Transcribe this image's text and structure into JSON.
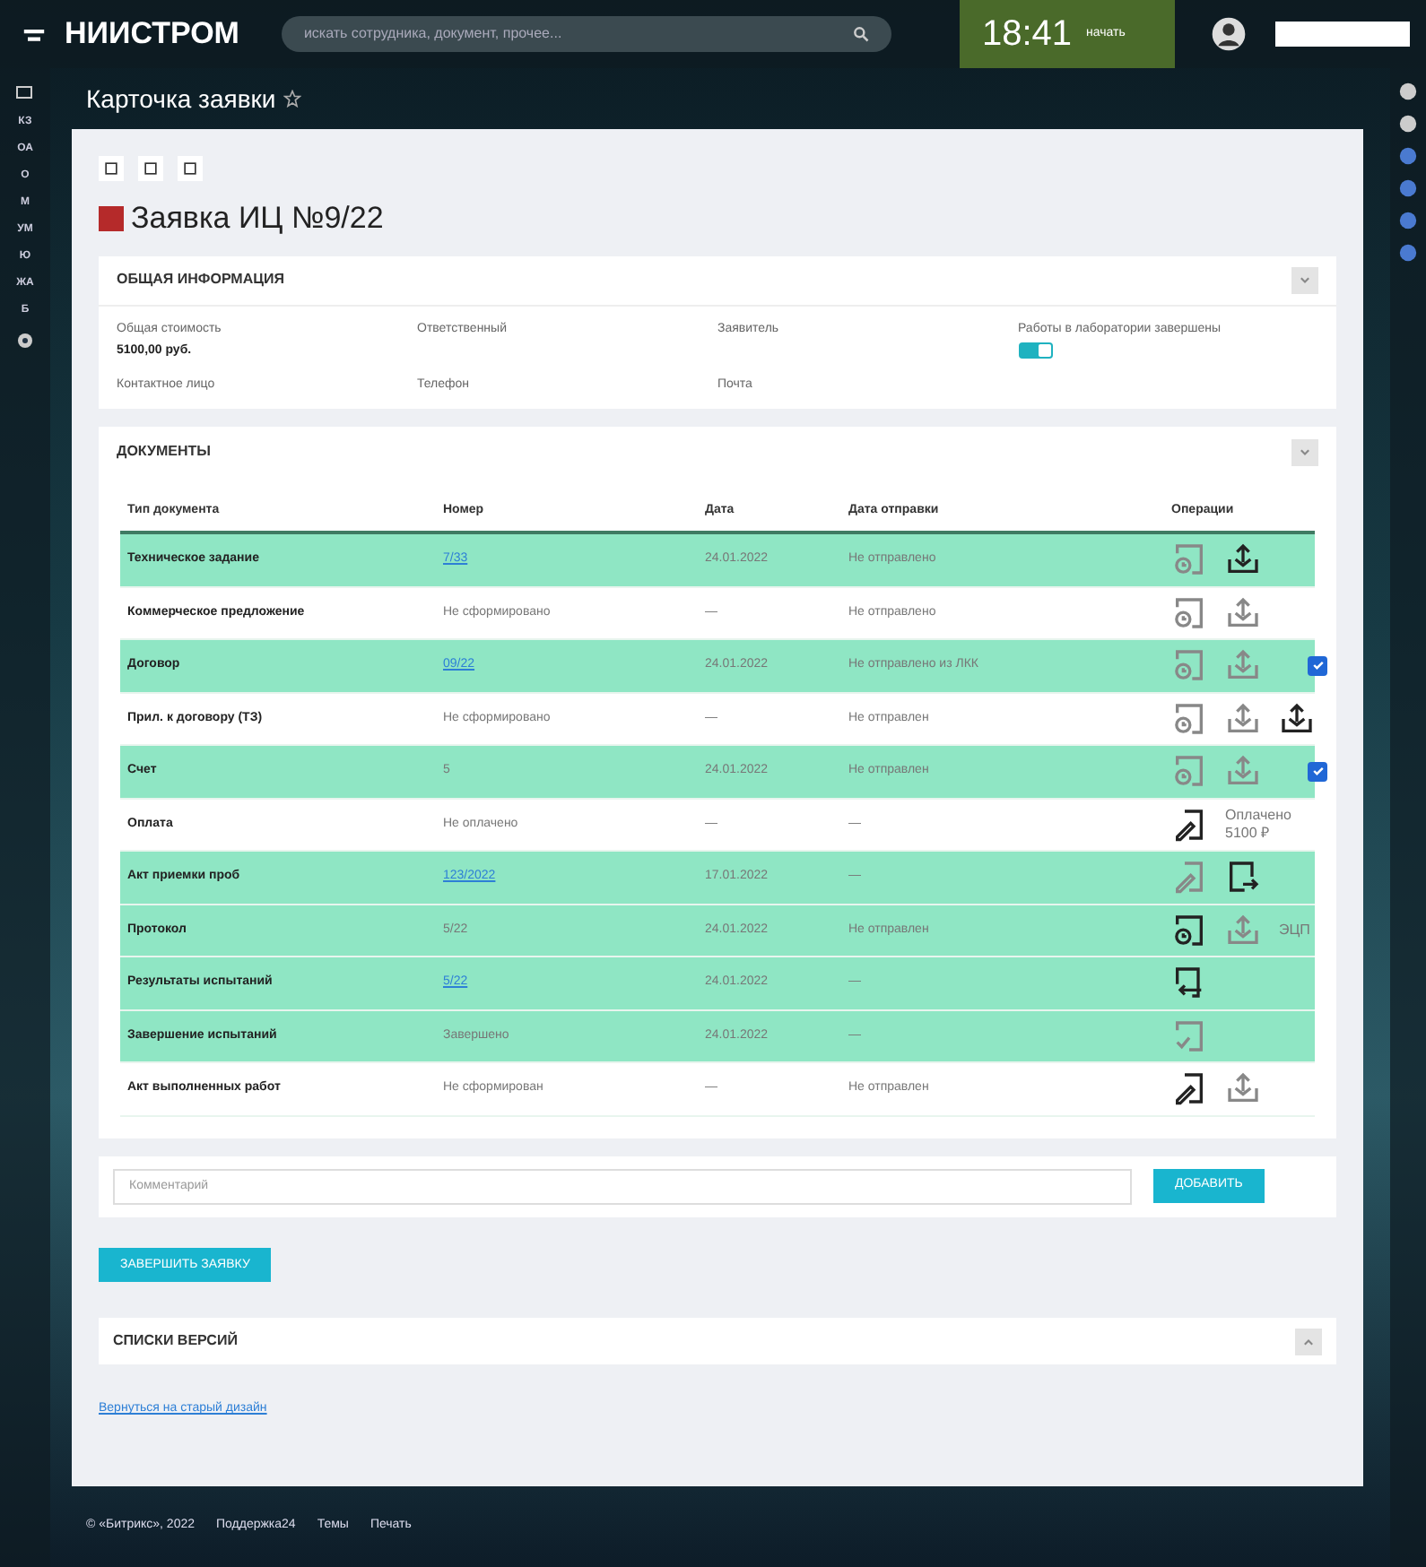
{
  "header": {
    "logo": "НИИСТРОМ",
    "search_placeholder": "искать сотрудника, документ, прочее...",
    "time": "18:41",
    "work_status": "начать"
  },
  "left_menu": [
    "КЗ",
    "ОА",
    "О",
    "М",
    "УМ",
    "Ю",
    "ЖА",
    "Б"
  ],
  "page_title": "Карточка заявки",
  "request": {
    "title": "Заявка ИЦ №9/22",
    "color": "#b52a2a"
  },
  "general": {
    "title": "ОБЩАЯ ИНФОРМАЦИЯ",
    "fields": [
      {
        "label": "Общая стоимость",
        "value": "5100,00 руб."
      },
      {
        "label": "Ответственный"
      },
      {
        "label": "Заявитель"
      },
      {
        "label": "Работы в лаборатории завершены",
        "kind": "toggle",
        "on": true
      },
      {
        "label": "Контактное лицо"
      },
      {
        "label": "Телефон"
      },
      {
        "label": "Почта"
      }
    ]
  },
  "documents": {
    "title": "ДОКУМЕНТЫ",
    "columns": [
      "Тип документа",
      "Номер",
      "Дата",
      "Дата отправки",
      "Операции"
    ],
    "rows": [
      {
        "type": "Техническое задание",
        "number": "7/33",
        "link": true,
        "date": "24.01.2022",
        "sent": "Не отправлено",
        "highlighted": true,
        "ops": [
          {
            "kind": "doc-clock",
            "active": false
          },
          {
            "kind": "upload",
            "active": true
          }
        ]
      },
      {
        "type": "Коммерческое предложение",
        "number": "Не сформировано",
        "link": false,
        "date": "—",
        "sent": "Не отправлено",
        "highlighted": false,
        "ops": [
          {
            "kind": "doc-clock",
            "active": false
          },
          {
            "kind": "upload",
            "active": false
          }
        ]
      },
      {
        "type": "Договор",
        "number": "09/22",
        "link": true,
        "date": "24.01.2022",
        "sent": "Не отправлено из ЛКК",
        "highlighted": true,
        "ops": [
          {
            "kind": "doc-clock",
            "active": false
          },
          {
            "kind": "upload",
            "active": false
          },
          {
            "kind": "checkbox",
            "checked": true
          }
        ]
      },
      {
        "type": "Прил. к договору (ТЗ)",
        "number": "Не сформировано",
        "link": false,
        "date": "—",
        "sent": "Не отправлен",
        "highlighted": false,
        "ops": [
          {
            "kind": "doc-clock",
            "active": false
          },
          {
            "kind": "upload",
            "active": false
          },
          {
            "kind": "upload",
            "active": true
          }
        ]
      },
      {
        "type": "Счет",
        "number": "5",
        "link": false,
        "date": "24.01.2022",
        "sent": "Не отправлен",
        "highlighted": true,
        "ops": [
          {
            "kind": "doc-clock",
            "active": false
          },
          {
            "kind": "upload",
            "active": false
          },
          {
            "kind": "checkbox",
            "checked": true
          }
        ]
      },
      {
        "type": "Оплата",
        "number": "Не оплачено",
        "link": false,
        "date": "—",
        "sent": "—",
        "highlighted": false,
        "ops": [
          {
            "kind": "edit-doc",
            "active": true
          },
          {
            "kind": "text",
            "text": "Оплачено 5100 ₽"
          }
        ]
      },
      {
        "type": "Акт приемки проб",
        "number": "123/2022",
        "link": true,
        "date": "17.01.2022",
        "sent": "—",
        "highlighted": true,
        "ops": [
          {
            "kind": "edit-doc",
            "active": false
          },
          {
            "kind": "export",
            "active": true
          }
        ]
      },
      {
        "type": "Протокол",
        "number": "5/22",
        "link": false,
        "date": "24.01.2022",
        "sent": "Не отправлен",
        "highlighted": true,
        "ops": [
          {
            "kind": "doc-clock",
            "active": true
          },
          {
            "kind": "upload",
            "active": false
          },
          {
            "kind": "text",
            "text": "ЭЦП"
          }
        ]
      },
      {
        "type": "Результаты испытаний",
        "number": "5/22",
        "link": true,
        "date": "24.01.2022",
        "sent": "—",
        "highlighted": true,
        "ops": [
          {
            "kind": "import",
            "active": true
          }
        ]
      },
      {
        "type": "Завершение испытаний",
        "number": "Завершено",
        "link": false,
        "date": "24.01.2022",
        "sent": "—",
        "highlighted": true,
        "ops": [
          {
            "kind": "doc-check",
            "active": false
          }
        ]
      },
      {
        "type": "Акт выполненных работ",
        "number": "Не сформирован",
        "link": false,
        "date": "—",
        "sent": "Не отправлен",
        "highlighted": false,
        "ops": [
          {
            "kind": "edit-doc",
            "active": true
          },
          {
            "kind": "upload",
            "active": false
          }
        ]
      }
    ]
  },
  "comment": {
    "placeholder": "Комментарий",
    "button": "ДОБАВИТЬ"
  },
  "finish_button": "ЗАВЕРШИТЬ ЗАЯВКУ",
  "versions": {
    "title": "СПИСКИ ВЕРСИЙ"
  },
  "old_design_link": "Вернуться на старый дизайн",
  "footer": [
    "© «Битрикс», 2022",
    "Поддержка24",
    "Темы",
    "Печать"
  ]
}
